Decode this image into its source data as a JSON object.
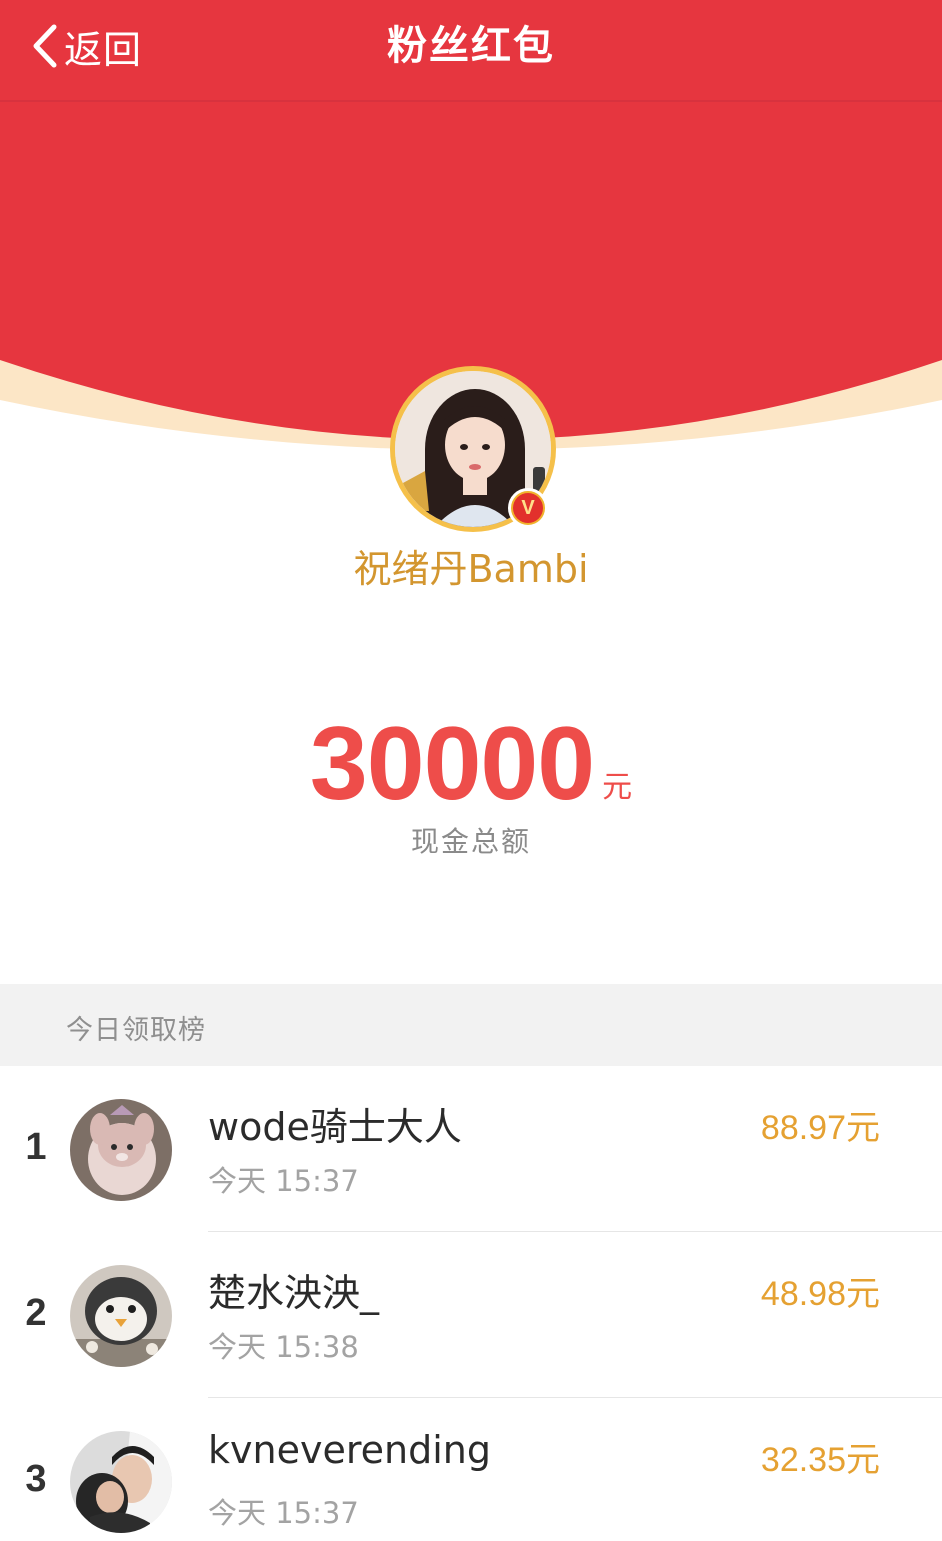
{
  "nav": {
    "back_label": "返回",
    "title": "粉丝红包"
  },
  "host": {
    "name": "祝绪丹Bambi",
    "verified_badge": "V"
  },
  "total": {
    "amount": "30000",
    "unit": "元",
    "caption": "现金总额"
  },
  "leaderboard": {
    "title": "今日领取榜",
    "rows": [
      {
        "rank": "1",
        "name": "wode骑士大人",
        "time": "今天 15:37",
        "amount": "88.97元"
      },
      {
        "rank": "2",
        "name": "楚水泱泱_",
        "time": "今天 15:38",
        "amount": "48.98元"
      },
      {
        "rank": "3",
        "name": "kvneverending",
        "time": "今天 15:37",
        "amount": "32.35元"
      }
    ]
  },
  "colors": {
    "header_red": "#e6363f",
    "arc_cream": "#fce6c6",
    "gold_text": "#d3962f",
    "amount_red": "#ee4d4a",
    "row_amount": "#e5a132"
  },
  "icons": {
    "back": "chevron-left-icon",
    "verified": "verified-v-icon"
  }
}
